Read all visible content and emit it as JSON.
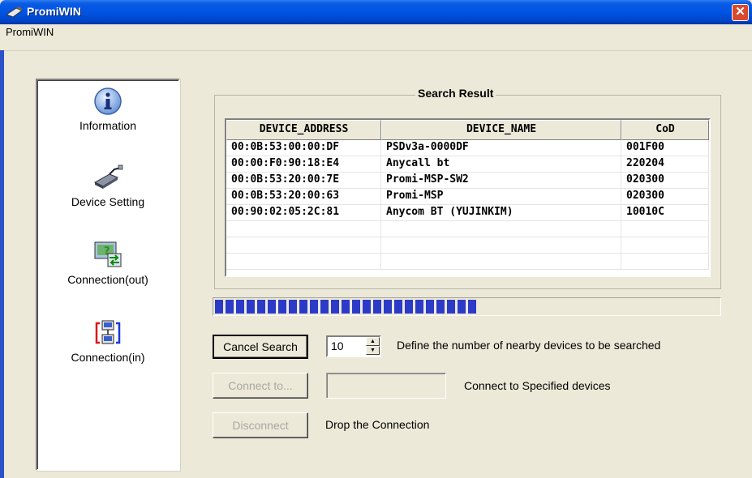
{
  "window": {
    "title": "PromiWIN",
    "close_glyph": "✕"
  },
  "menu": {
    "items": [
      "PromiWIN"
    ]
  },
  "sidebar": {
    "items": [
      {
        "label": "Information",
        "icon": "info-icon"
      },
      {
        "label": "Device Setting",
        "icon": "device-adapter-icon"
      },
      {
        "label": "Connection(out)",
        "icon": "connection-out-icon"
      },
      {
        "label": "Connection(in)",
        "icon": "connection-in-icon"
      }
    ]
  },
  "search_result": {
    "title": "Search Result",
    "columns": [
      "DEVICE_ADDRESS",
      "DEVICE_NAME",
      "CoD"
    ],
    "rows": [
      [
        "00:0B:53:00:00:DF",
        "PSDv3a-0000DF",
        "001F00"
      ],
      [
        "00:00:F0:90:18:E4",
        "Anycall bt",
        "220204"
      ],
      [
        "00:0B:53:20:00:7E",
        "Promi-MSP-SW2",
        "020300"
      ],
      [
        "00:0B:53:20:00:63",
        "Promi-MSP",
        "020300"
      ],
      [
        "00:90:02:05:2C:81",
        "Anycom BT (YUJINKIM)",
        "10010C"
      ],
      [
        "",
        "",
        ""
      ],
      [
        "",
        "",
        ""
      ],
      [
        "",
        "",
        ""
      ]
    ]
  },
  "progress": {
    "value": 0.52,
    "accent": "#2B3BC8"
  },
  "controls": {
    "cancel_search_label": "Cancel Search",
    "device_count_value": "10",
    "device_count_hint": "Define the number of nearby devices to be searched",
    "connect_label": "Connect to...",
    "connect_value": "",
    "connect_hint": "Connect to Specified devices",
    "disconnect_label": "Disconnect",
    "disconnect_hint": "Drop the Connection"
  }
}
